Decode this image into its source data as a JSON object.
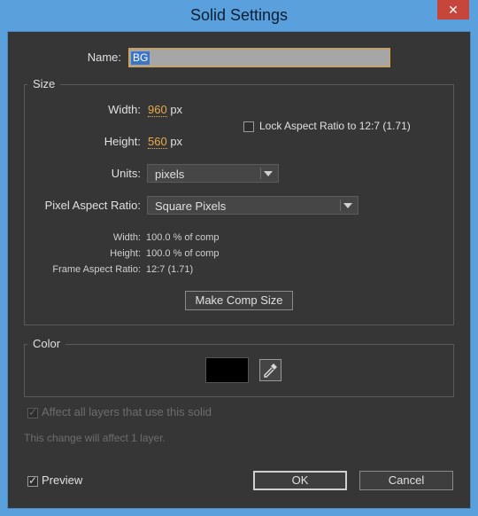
{
  "window": {
    "title": "Solid Settings",
    "close_glyph": "✕"
  },
  "name": {
    "label": "Name:",
    "value": "BG"
  },
  "size": {
    "group_title": "Size",
    "width_label": "Width:",
    "width_value": "960",
    "width_unit": "px",
    "height_label": "Height:",
    "height_value": "560",
    "height_unit": "px",
    "lock_label": "Lock Aspect Ratio to 12:7 (1.71)",
    "lock_checked": false,
    "units_label": "Units:",
    "units_value": "pixels",
    "par_label": "Pixel Aspect Ratio:",
    "par_value": "Square Pixels",
    "info": {
      "width_label": "Width:",
      "width_value": "100.0 % of comp",
      "height_label": "Height:",
      "height_value": "100.0 % of comp",
      "far_label": "Frame Aspect Ratio:",
      "far_value": "12:7 (1.71)"
    },
    "make_comp_size_label": "Make Comp Size"
  },
  "color": {
    "group_title": "Color",
    "swatch_color": "#000000",
    "eyedropper_icon": "eyedropper-icon"
  },
  "affect": {
    "label": "Affect all layers that use this solid",
    "checked": true,
    "enabled": false
  },
  "change_note": "This change will affect 1 layer.",
  "preview": {
    "label": "Preview",
    "checked": true
  },
  "buttons": {
    "ok_label": "OK",
    "cancel_label": "Cancel"
  }
}
